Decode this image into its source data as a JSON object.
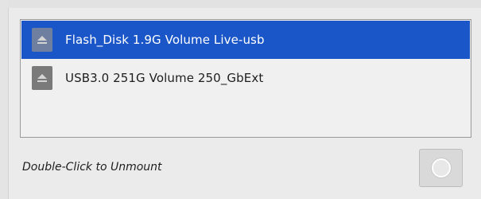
{
  "devices": [
    {
      "label": "Flash_Disk 1.9G Volume Live-usb",
      "selected": true
    },
    {
      "label": "USB3.0 251G Volume 250_GbExt",
      "selected": false
    }
  ],
  "footer": {
    "hint": "Double-Click to Unmount"
  },
  "colors": {
    "selection": "#1b56c9",
    "background": "#ebebeb"
  }
}
